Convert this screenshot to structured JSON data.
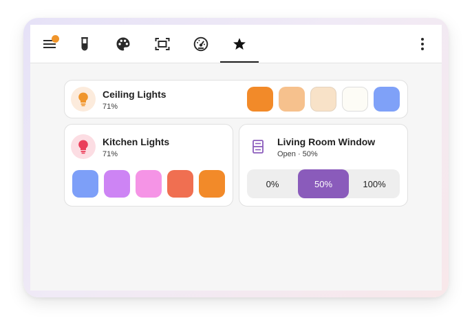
{
  "toolbar": {
    "icons": [
      "menu-icon",
      "flask-icon",
      "palette-icon",
      "scan-frame-icon",
      "gauge-icon",
      "star-icon",
      "more-vert-icon"
    ],
    "notification_color": "#f0952b",
    "active_tab": "star-icon"
  },
  "cards": {
    "ceiling": {
      "title": "Ceiling Lights",
      "subtitle": "71%",
      "icon": "lightbulb-icon",
      "icon_color": "#f0952b",
      "swatches": [
        "#f28a29",
        "#f6c18d",
        "#f8e2c8",
        "#fdfcf6",
        "#7fa1f8"
      ]
    },
    "kitchen": {
      "title": "Kitchen Lights",
      "subtitle": "71%",
      "icon": "lightbulb-icon",
      "icon_color": "#ea3e5a",
      "swatches": [
        "#7d9ff8",
        "#cd84f4",
        "#f594e6",
        "#f06f51",
        "#f28a29"
      ]
    },
    "window": {
      "title": "Living Room Window",
      "subtitle": "Open · 50%",
      "icon": "window-icon",
      "icon_color": "#8a5bbb",
      "options": [
        "0%",
        "50%",
        "100%"
      ],
      "selected": "50%",
      "accent": "#8a5bbb"
    }
  }
}
